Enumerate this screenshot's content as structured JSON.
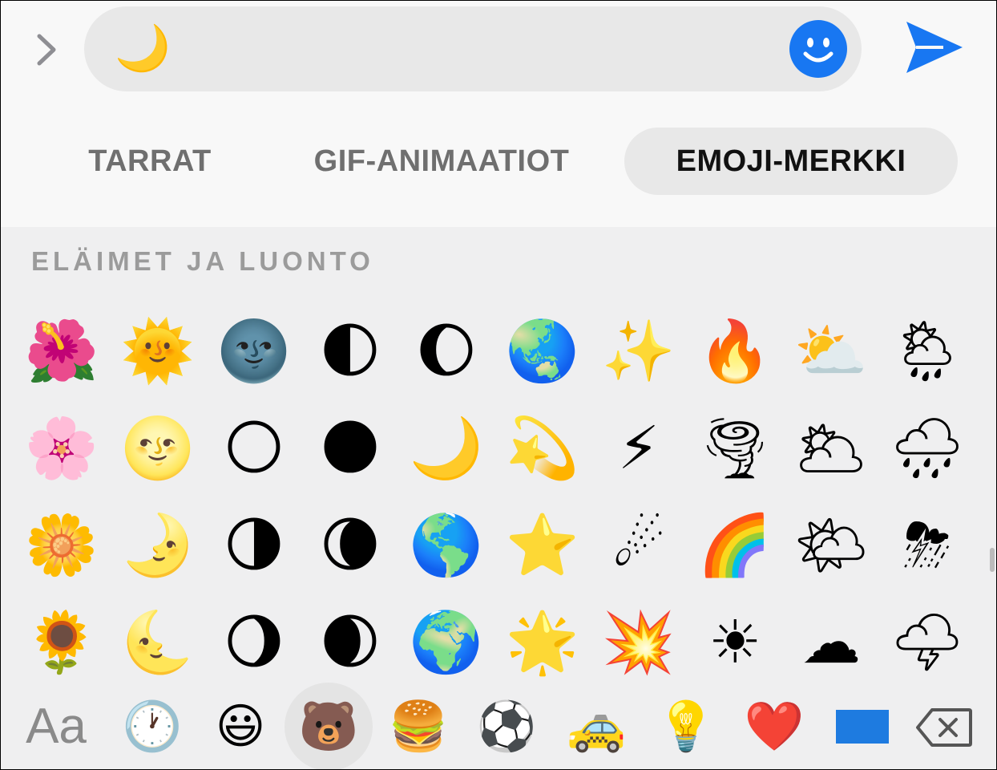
{
  "header": {
    "back_icon": "chevron-right-icon",
    "message_text": "🌙",
    "emoji_button_icon": "smiley-icon",
    "send_icon": "send-icon",
    "accent_color": "#1877f2"
  },
  "tabs": [
    {
      "label": "TARRAT"
    },
    {
      "label": "GIF-ANIMAATIOT"
    },
    {
      "label": "EMOJI-MERKKI",
      "active": true
    }
  ],
  "section": {
    "title": "ELÄIMET JA LUONTO"
  },
  "emoji_rows": [
    [
      "🌺",
      "🌞",
      "🌚",
      "🌓",
      "🌔",
      "🌏",
      "✨",
      "🔥",
      "⛅",
      "🌦"
    ],
    [
      "🌸",
      "🌝",
      "🌕",
      "🌑",
      "🌙",
      "💫",
      "⚡",
      "🌪",
      "🌥",
      "🌧"
    ],
    [
      "🌼",
      "🌛",
      "🌗",
      "🌘",
      "🌎",
      "⭐",
      "☄",
      "🌈",
      "🌤",
      "⛈"
    ],
    [
      "🌻",
      "🌜",
      "🌖",
      "🌒",
      "🌍",
      "🌟",
      "💥",
      "☀",
      "☁",
      "🌩"
    ]
  ],
  "categories": [
    {
      "label": "Aa",
      "icon": "text-icon"
    },
    {
      "label": "🕐",
      "icon": "clock-icon"
    },
    {
      "label": "😃",
      "icon": "smiley-icon"
    },
    {
      "label": "🐻",
      "icon": "bear-icon",
      "active": true
    },
    {
      "label": "🍔",
      "icon": "burger-icon"
    },
    {
      "label": "⚽",
      "icon": "soccer-ball-icon"
    },
    {
      "label": "🚕",
      "icon": "taxi-icon"
    },
    {
      "label": "💡",
      "icon": "lightbulb-icon"
    },
    {
      "label": "❤️",
      "icon": "heart-icon"
    },
    {
      "label": "",
      "icon": "flag-icon"
    },
    {
      "label": "",
      "icon": "backspace-icon"
    }
  ]
}
